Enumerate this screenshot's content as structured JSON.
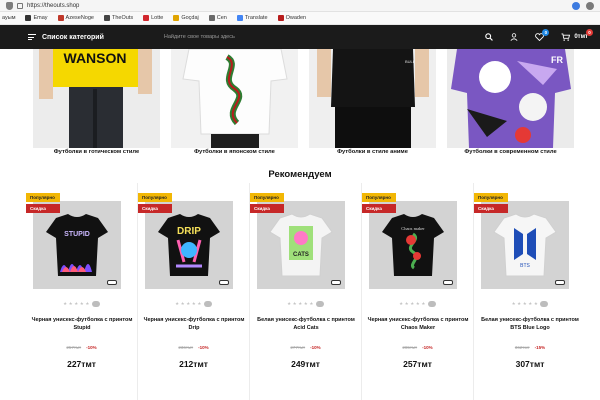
{
  "browser": {
    "url": "https://theouts.shop",
    "bookmarks": [
      "ауым",
      "Emay",
      "AzeseNoge",
      "TheOuts",
      "Lotte",
      "Goçdaj",
      "Cen",
      "Translate",
      "Owaden"
    ]
  },
  "header": {
    "menu_label": "Список категорий",
    "search_placeholder": "Найдите свое товары здесь",
    "wishlist_count": "0",
    "cart_count": "0",
    "cart_total": "0тмт"
  },
  "categories": [
    {
      "label": "Футболки в готическом стиле"
    },
    {
      "label": "Футболки в японском стиле"
    },
    {
      "label": "Футболки в стиле аниме"
    },
    {
      "label": "Футболки в современном стиле"
    }
  ],
  "section_title": "Рекомендуем",
  "product_badges": {
    "popular": "Популярно",
    "sale": "Скидка"
  },
  "products": [
    {
      "name": "Черная унисекс-футболка с принтом Stupid",
      "old_price": "257тмт",
      "discount": "-10%",
      "price": "227тмт",
      "shirt_color": "#111111",
      "print_text": "STUPID"
    },
    {
      "name": "Черная унисекс-футболка с принтом Drip",
      "old_price": "236тмт",
      "discount": "-10%",
      "price": "212тмт",
      "shirt_color": "#111111",
      "print_text": "DRIP"
    },
    {
      "name": "Белая унисекс-футболка с принтом Acid Cats",
      "old_price": "277тмт",
      "discount": "-10%",
      "price": "249тмт",
      "shirt_color": "#f4f4f4",
      "print_text": "CATS"
    },
    {
      "name": "Черная унисекс-футболка с принтом Chaos Maker",
      "old_price": "285тмт",
      "discount": "-10%",
      "price": "257тмт",
      "shirt_color": "#111111",
      "print_text": "Chaos maker"
    },
    {
      "name": "Белая унисекс-футболка с принтом BTS Blue Logo",
      "old_price": "362тмт",
      "discount": "-15%",
      "price": "307тмт",
      "shirt_color": "#f4f4f4",
      "print_text": "BTS"
    }
  ],
  "colors": {
    "header_bg": "#1b1b1b",
    "popular_badge": "#f2b705",
    "sale_badge": "#c62828",
    "accent_blue": "#1e88e5"
  }
}
